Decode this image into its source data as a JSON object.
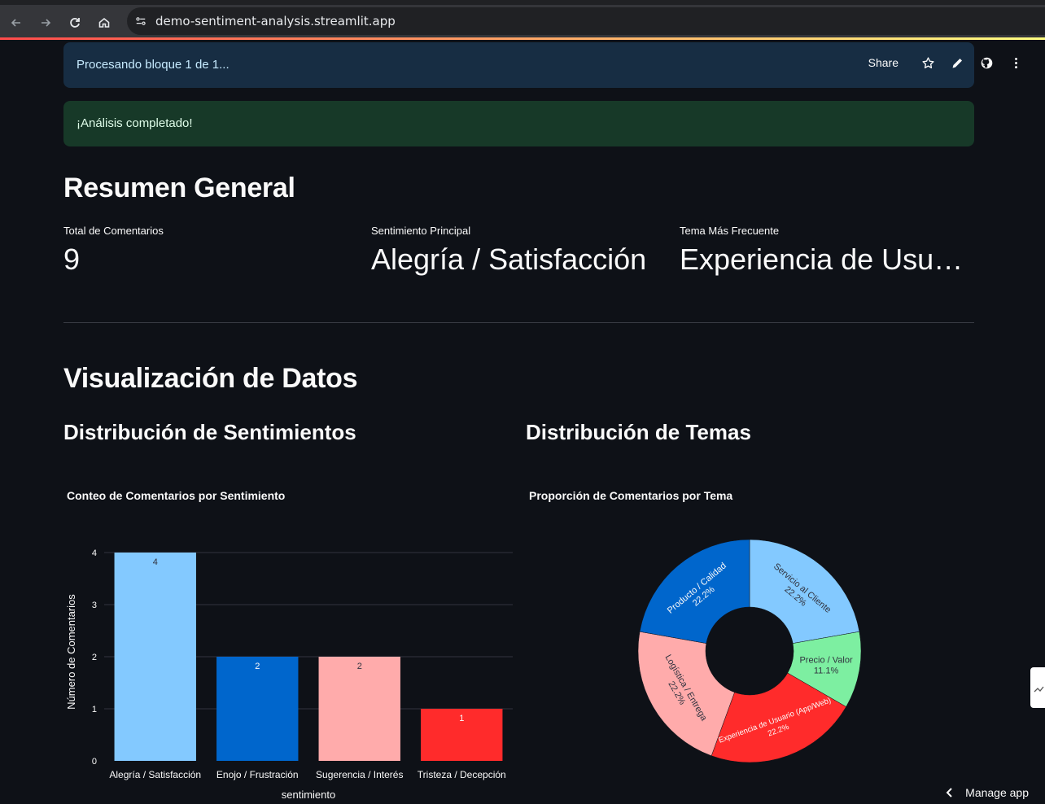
{
  "browser": {
    "url": "demo-sentiment-analysis.streamlit.app"
  },
  "toolbar": {
    "share_label": "Share"
  },
  "status": {
    "info": "Procesando bloque 1 de 1...",
    "success": "¡Análisis completado!"
  },
  "summary": {
    "title": "Resumen General",
    "metrics": [
      {
        "label": "Total de Comentarios",
        "value": "9"
      },
      {
        "label": "Sentimiento Principal",
        "value": "Alegría / Satisfacción"
      },
      {
        "label": "Tema Más Frecuente",
        "value": "Experiencia de Usuario (App/Web)"
      }
    ]
  },
  "viz": {
    "title": "Visualización de Datos",
    "left_heading": "Distribución de Sentimientos",
    "right_heading": "Distribución de Temas"
  },
  "footer": {
    "manage_app": "Manage app"
  },
  "colors": {
    "accent_blue": "#0066cc",
    "light_blue": "#83c9ff",
    "pink": "#ffabab",
    "red": "#ff2b2b",
    "green": "#7defa1"
  },
  "chart_data": [
    {
      "type": "bar",
      "title": "Conteo de Comentarios por Sentimiento",
      "xlabel": "sentimiento",
      "ylabel": "Número de Comentarios",
      "categories": [
        "Alegría / Satisfacción",
        "Enojo / Frustración",
        "Sugerencia / Interés",
        "Tristeza / Decepción"
      ],
      "values": [
        4,
        2,
        2,
        1
      ],
      "colors": [
        "#83c9ff",
        "#0066cc",
        "#ffabab",
        "#ff2b2b"
      ],
      "ylim": [
        0,
        4
      ],
      "yticks": [
        0,
        1,
        2,
        3,
        4
      ],
      "grid": true
    },
    {
      "type": "pie",
      "title": "Proporción de Comentarios por Tema",
      "hole": true,
      "slices": [
        {
          "label": "Servicio al Cliente",
          "percent": "22.2%",
          "value": 2,
          "color": "#83c9ff"
        },
        {
          "label": "Precio / Valor",
          "percent": "11.1%",
          "value": 1,
          "color": "#7defa1"
        },
        {
          "label": "Experiencia de Usuario (App/Web)",
          "percent": "22.2%",
          "value": 2,
          "color": "#ff2b2b"
        },
        {
          "label": "Logística / Entrega",
          "percent": "22.2%",
          "value": 2,
          "color": "#ffabab"
        },
        {
          "label": "Producto / Calidad",
          "percent": "22.2%",
          "value": 2,
          "color": "#0066cc"
        }
      ]
    }
  ]
}
